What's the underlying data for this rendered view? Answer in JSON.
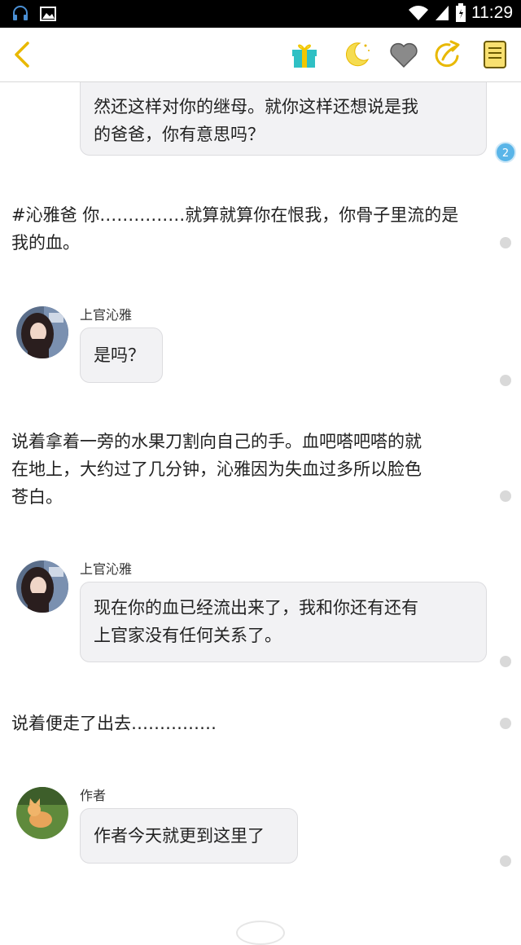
{
  "status": {
    "time": "11:29"
  },
  "icons": {
    "back": "chevron-left-icon",
    "gift": "gift-icon",
    "night": "moon-icon",
    "favorite": "heart-icon",
    "share": "share-icon",
    "catalog": "book-icon"
  },
  "colors": {
    "accent": "#e8b800",
    "gift": "#27b3b8",
    "heart": "#8a8a8a",
    "badge": "#5ab5e8"
  },
  "chat": {
    "top_bubble": {
      "line1": "然还这样对你的继母。就你这样还想说是我",
      "line2": "的爸爸，你有意思吗？",
      "comment_count": "2"
    },
    "narration1": {
      "line1": "#沁雅爸 你……………就算就算你在恨我，你骨子里流的是",
      "line2": "我的血。"
    },
    "msg1": {
      "speaker": "上官沁雅",
      "text": "是吗？"
    },
    "narration2": {
      "line1": "说着拿着一旁的水果刀割向自己的手。血吧嗒吧嗒的就",
      "line2": "在地上，大约过了几分钟，沁雅因为失血过多所以脸色",
      "line3": "苍白。"
    },
    "msg2": {
      "speaker": "上官沁雅",
      "line1": "现在你的血已经流出来了，我和你还有还有",
      "line2": "上官家没有任何关系了。"
    },
    "narration3": {
      "line1": "说着便走了出去……………"
    },
    "msg3": {
      "speaker": "作者",
      "text": "作者今天就更到这里了"
    }
  }
}
